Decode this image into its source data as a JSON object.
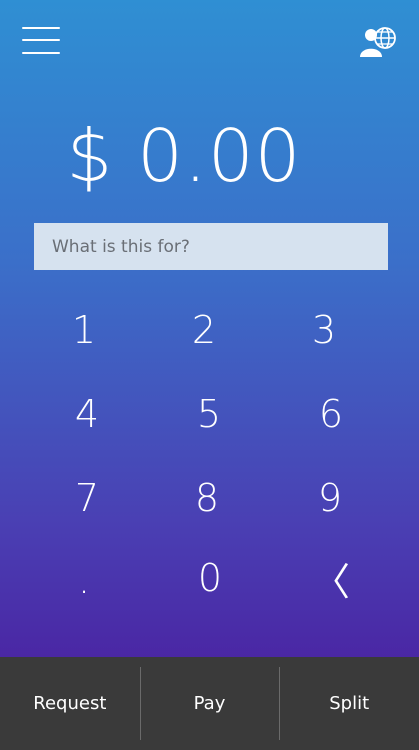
{
  "header": {
    "menu_icon": "hamburger-icon",
    "profile_icon": "user-globe-icon"
  },
  "amount": {
    "display": "$ 0.00"
  },
  "memo": {
    "placeholder": "What is this for?",
    "value": ""
  },
  "keypad": {
    "keys": [
      "1",
      "2",
      "3",
      "4",
      "5",
      "6",
      "7",
      "8",
      "9",
      ".",
      "0",
      "〈"
    ]
  },
  "actions": {
    "request": "Request",
    "pay": "Pay",
    "split": "Split"
  },
  "colors": {
    "gradient_top": "#2f8fd3",
    "gradient_bottom": "#4b169a",
    "memo_bg": "#d6e2ef",
    "bottom_bar": "#3a3a3a"
  }
}
